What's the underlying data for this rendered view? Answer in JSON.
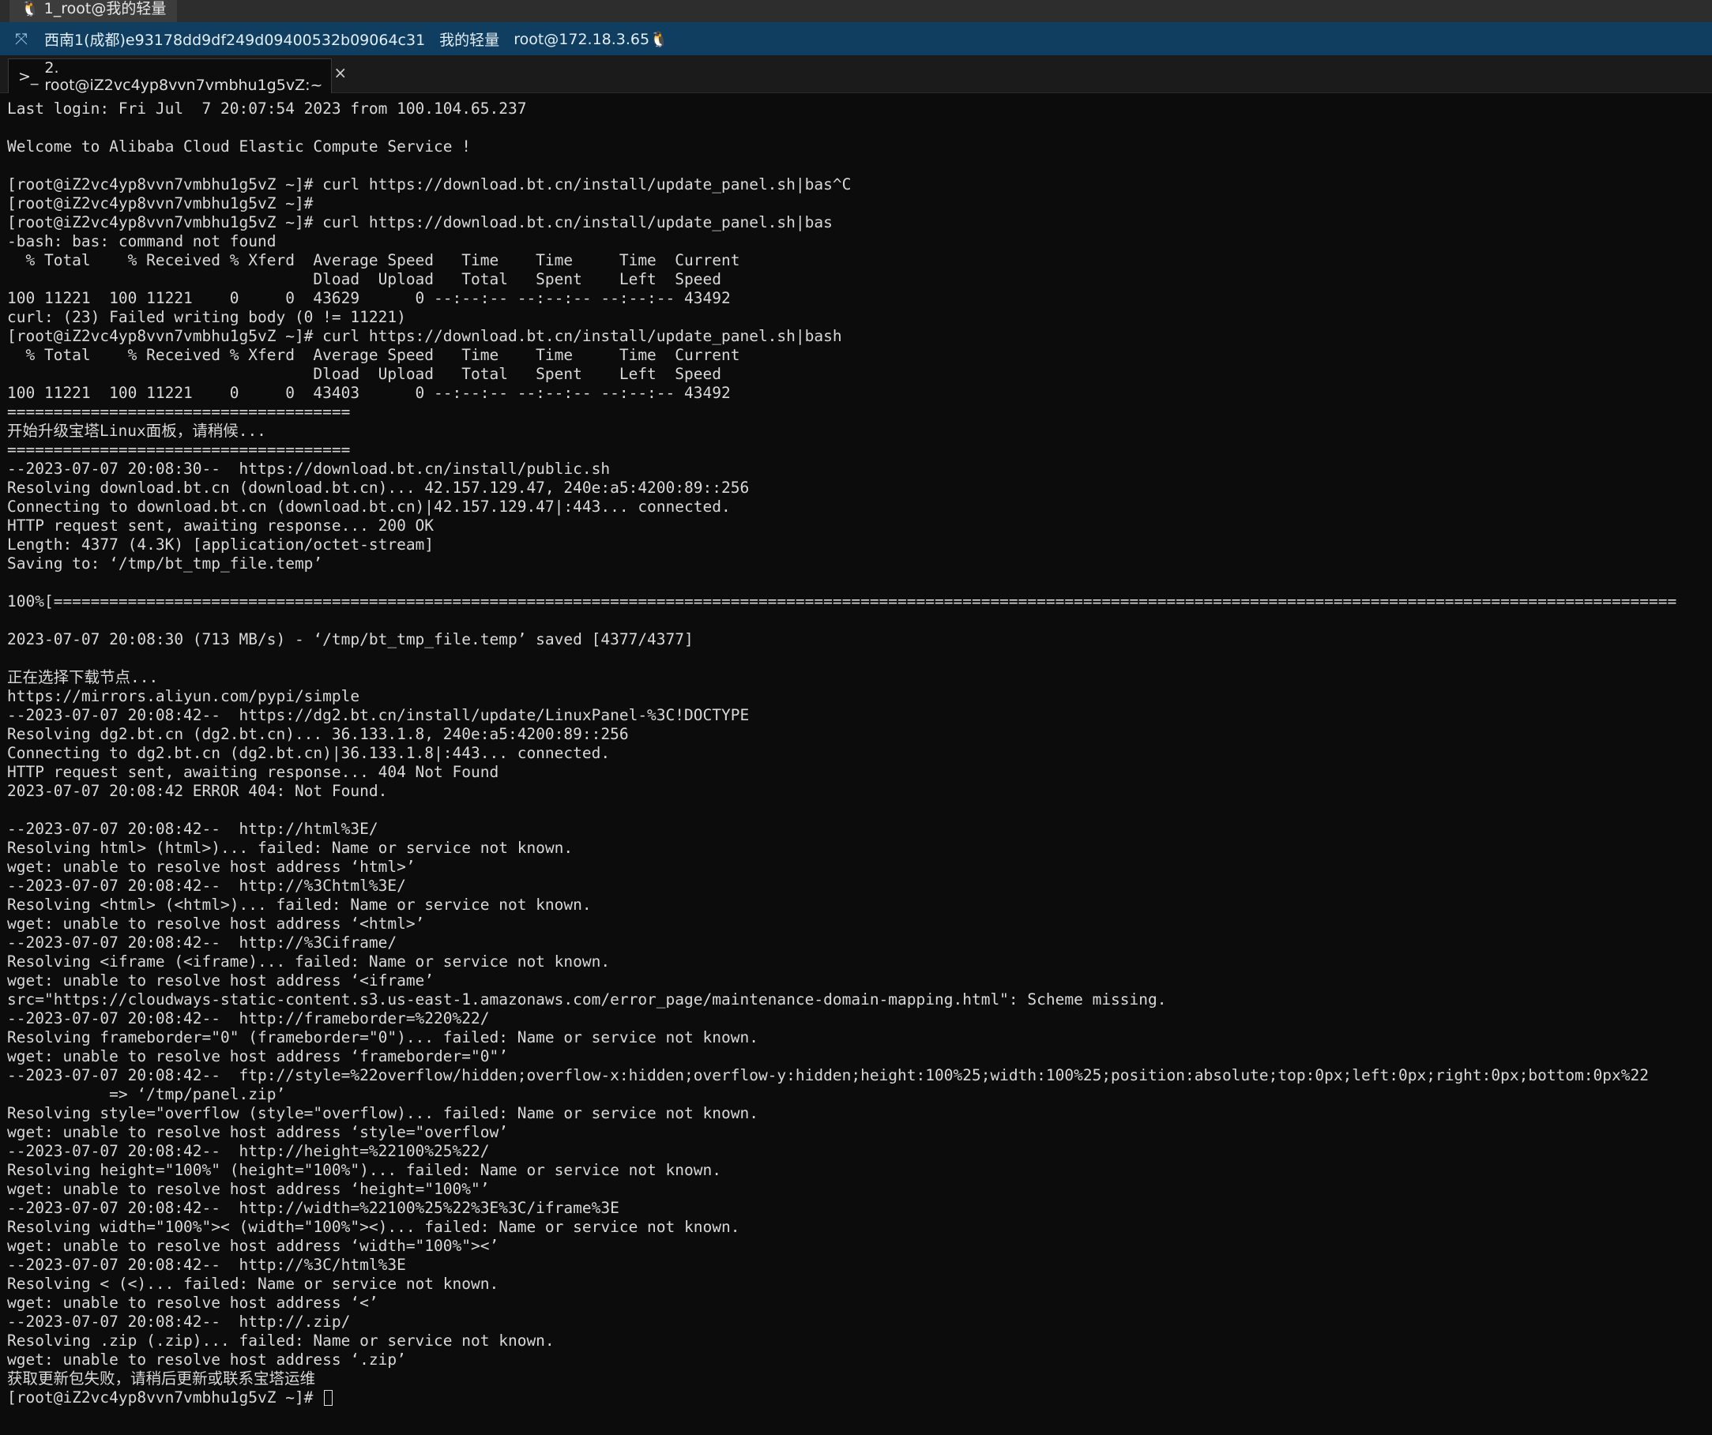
{
  "window_tab": {
    "icon": "linux-penguin-icon",
    "title": "1_root@我的轻量"
  },
  "info_bar": {
    "region": "西南1(成都)e93178dd9df249d09400532b09064c31",
    "name": "我的轻量",
    "user": "root@172.18.3.65"
  },
  "session_tab": {
    "prompt_glyph": ">_",
    "title": "2. root@iZ2vc4yp8vvn7vmbhu1g5vZ:~",
    "close": "×"
  },
  "terminal": {
    "lines": [
      "Last login: Fri Jul  7 20:07:54 2023 from 100.104.65.237",
      "",
      "Welcome to Alibaba Cloud Elastic Compute Service !",
      "",
      "[root@iZ2vc4yp8vvn7vmbhu1g5vZ ~]# curl https://download.bt.cn/install/update_panel.sh|bas^C",
      "[root@iZ2vc4yp8vvn7vmbhu1g5vZ ~]#",
      "[root@iZ2vc4yp8vvn7vmbhu1g5vZ ~]# curl https://download.bt.cn/install/update_panel.sh|bas",
      "-bash: bas: command not found",
      "  % Total    % Received % Xferd  Average Speed   Time    Time     Time  Current",
      "                                 Dload  Upload   Total   Spent    Left  Speed",
      "100 11221  100 11221    0     0  43629      0 --:--:-- --:--:-- --:--:-- 43492",
      "curl: (23) Failed writing body (0 != 11221)",
      "[root@iZ2vc4yp8vvn7vmbhu1g5vZ ~]# curl https://download.bt.cn/install/update_panel.sh|bash",
      "  % Total    % Received % Xferd  Average Speed   Time    Time     Time  Current",
      "                                 Dload  Upload   Total   Spent    Left  Speed",
      "100 11221  100 11221    0     0  43403      0 --:--:-- --:--:-- --:--:-- 43492",
      "=====================================",
      "开始升级宝塔Linux面板，请稍候...",
      "=====================================",
      "--2023-07-07 20:08:30--  https://download.bt.cn/install/public.sh",
      "Resolving download.bt.cn (download.bt.cn)... 42.157.129.47, 240e:a5:4200:89::256",
      "Connecting to download.bt.cn (download.bt.cn)|42.157.129.47|:443... connected.",
      "HTTP request sent, awaiting response... 200 OK",
      "Length: 4377 (4.3K) [application/octet-stream]",
      "Saving to: ‘/tmp/bt_tmp_file.temp’",
      "",
      "100%[===============================================================================================================================================================================",
      "",
      "2023-07-07 20:08:30 (713 MB/s) - ‘/tmp/bt_tmp_file.temp’ saved [4377/4377]",
      "",
      "正在选择下载节点...",
      "https://mirrors.aliyun.com/pypi/simple",
      "--2023-07-07 20:08:42--  https://dg2.bt.cn/install/update/LinuxPanel-%3C!DOCTYPE",
      "Resolving dg2.bt.cn (dg2.bt.cn)... 36.133.1.8, 240e:a5:4200:89::256",
      "Connecting to dg2.bt.cn (dg2.bt.cn)|36.133.1.8|:443... connected.",
      "HTTP request sent, awaiting response... 404 Not Found",
      "2023-07-07 20:08:42 ERROR 404: Not Found.",
      "",
      "--2023-07-07 20:08:42--  http://html%3E/",
      "Resolving html> (html>)... failed: Name or service not known.",
      "wget: unable to resolve host address ‘html>’",
      "--2023-07-07 20:08:42--  http://%3Chtml%3E/",
      "Resolving <html> (<html>)... failed: Name or service not known.",
      "wget: unable to resolve host address ‘<html>’",
      "--2023-07-07 20:08:42--  http://%3Ciframe/",
      "Resolving <iframe (<iframe)... failed: Name or service not known.",
      "wget: unable to resolve host address ‘<iframe’",
      "src=\"https://cloudways-static-content.s3.us-east-1.amazonaws.com/error_page/maintenance-domain-mapping.html\": Scheme missing.",
      "--2023-07-07 20:08:42--  http://frameborder=%220%22/",
      "Resolving frameborder=\"0\" (frameborder=\"0\")... failed: Name or service not known.",
      "wget: unable to resolve host address ‘frameborder=\"0\"’",
      "--2023-07-07 20:08:42--  ftp://style=%22overflow/hidden;overflow-x:hidden;overflow-y:hidden;height:100%25;width:100%25;position:absolute;top:0px;left:0px;right:0px;bottom:0px%22",
      "           => ‘/tmp/panel.zip’",
      "Resolving style=\"overflow (style=\"overflow)... failed: Name or service not known.",
      "wget: unable to resolve host address ‘style=\"overflow’",
      "--2023-07-07 20:08:42--  http://height=%22100%25%22/",
      "Resolving height=\"100%\" (height=\"100%\")... failed: Name or service not known.",
      "wget: unable to resolve host address ‘height=\"100%\"’",
      "--2023-07-07 20:08:42--  http://width=%22100%25%22%3E%3C/iframe%3E",
      "Resolving width=\"100%\">< (width=\"100%\"><)... failed: Name or service not known.",
      "wget: unable to resolve host address ‘width=\"100%\"><’",
      "--2023-07-07 20:08:42--  http://%3C/html%3E",
      "Resolving < (<)... failed: Name or service not known.",
      "wget: unable to resolve host address ‘<’",
      "--2023-07-07 20:08:42--  http://.zip/",
      "Resolving .zip (.zip)... failed: Name or service not known.",
      "wget: unable to resolve host address ‘.zip’",
      "获取更新包失败，请稍后更新或联系宝塔运维",
      "[root@iZ2vc4yp8vvn7vmbhu1g5vZ ~]# "
    ]
  },
  "colors": {
    "background": "#0c0c0c",
    "text": "#d9d9d9",
    "info_bar": "#0f3e61"
  }
}
